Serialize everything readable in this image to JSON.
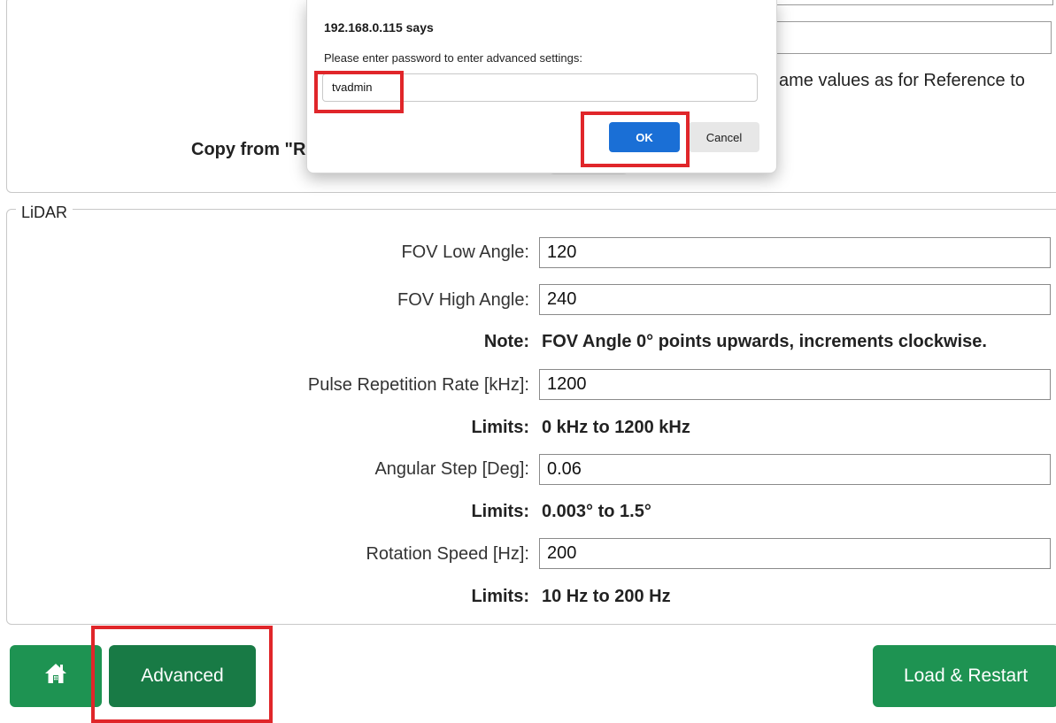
{
  "top_section": {
    "partial_text": "ame values as for Reference to",
    "copy_label": "Copy from \"Re"
  },
  "lidar": {
    "legend": "LiDAR",
    "fov_low": {
      "label": "FOV Low Angle:",
      "value": "120"
    },
    "fov_high": {
      "label": "FOV High Angle:",
      "value": "240"
    },
    "note": {
      "label": "Note:",
      "text": "FOV Angle 0° points upwards, increments clockwise."
    },
    "pulse_rate": {
      "label": "Pulse Repetition Rate [kHz]:",
      "value": "1200"
    },
    "pulse_limits": {
      "label": "Limits:",
      "text": "0 kHz to 1200 kHz"
    },
    "angular_step": {
      "label": "Angular Step [Deg]:",
      "value": "0.06"
    },
    "angular_limits": {
      "label": "Limits:",
      "text": "0.003° to 1.5°"
    },
    "rotation_speed": {
      "label": "Rotation Speed [Hz]:",
      "value": "200"
    },
    "rotation_limits": {
      "label": "Limits:",
      "text": "10 Hz to 200 Hz"
    }
  },
  "buttons": {
    "home_icon": "home-icon",
    "advanced": "Advanced",
    "load_restart": "Load & Restart"
  },
  "dialog": {
    "title": "192.168.0.115 says",
    "message": "Please enter password to enter advanced settings:",
    "input_value": "tvadmin",
    "ok": "OK",
    "cancel": "Cancel"
  },
  "colors": {
    "primary_green": "#1e9352",
    "dark_green": "#187a45",
    "highlight_red": "#e0262a",
    "dialog_blue": "#1a6fd6"
  }
}
